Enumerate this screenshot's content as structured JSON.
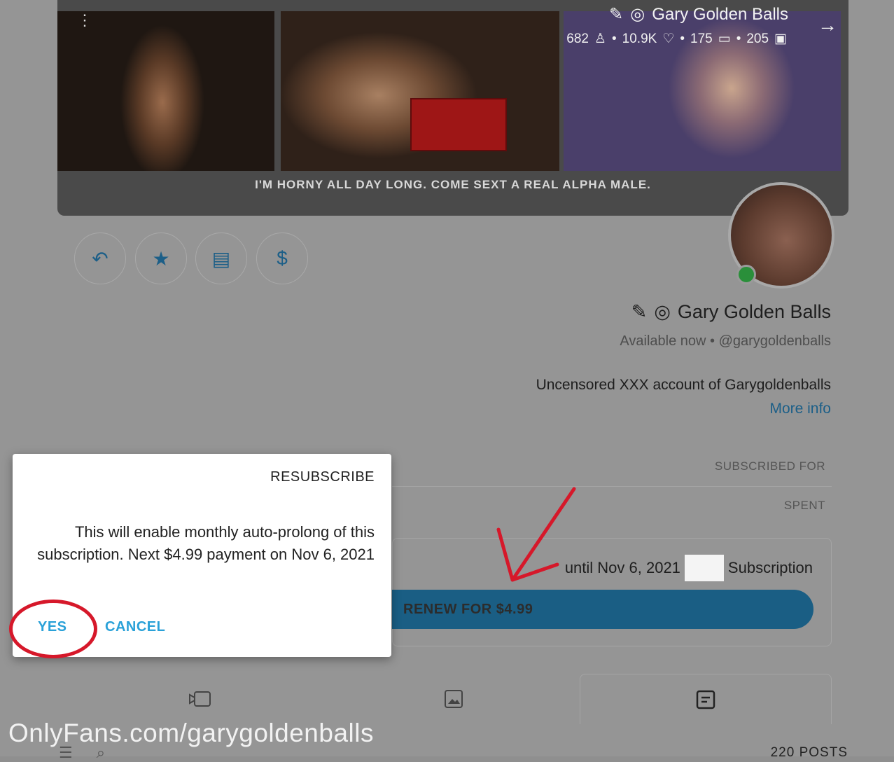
{
  "banner": {
    "name": "Gary Golden Balls",
    "stats": {
      "photos": "205",
      "videos": "175",
      "likes": "10.9K",
      "fans": "682"
    },
    "tagline": "I'M HORNY ALL DAY LONG. COME SEXT A REAL ALPHA MALE."
  },
  "profile": {
    "name": "Gary Golden Balls",
    "handle": "@garygoldenballs",
    "status": "Available now",
    "bio": "Uncensored XXX account of Garygoldenballs",
    "more_info": "More info"
  },
  "subscription": {
    "subscribed_for_label": "SUBSCRIBED FOR",
    "spent_label": "SPENT",
    "text_prefix": "Subscription",
    "text_suffix": "until Nov 6, 2021",
    "renew_label": "RENEW FOR $4.99"
  },
  "posts_count": "220 POSTS",
  "watermark": "OnlyFans.com/garygoldenballs",
  "dialog": {
    "title": "RESUBSCRIBE",
    "body": "This will enable monthly auto-prolong of this subscription. Next $4.99 payment on Nov 6, 2021",
    "cancel_label": "CANCEL",
    "yes_label": "YES"
  },
  "colors": {
    "accent": "#2aa1d8",
    "annotation_red": "#d6182a",
    "overlay": "#959595"
  }
}
